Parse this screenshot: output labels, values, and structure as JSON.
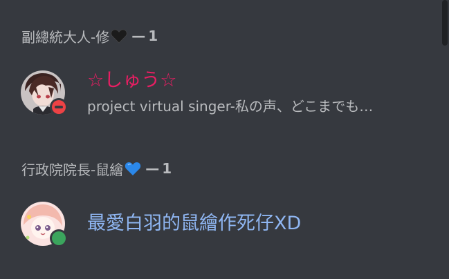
{
  "member_list": {
    "groups": [
      {
        "role": "副總統大人-修",
        "heart_emoji": "black-heart",
        "separator": "—",
        "count": "1",
        "members": [
          {
            "name": "☆しゅう☆",
            "activity": "project virtual singer-私の声、どこまでも…",
            "status": "do-not-disturb",
            "name_color": "#e91e63"
          }
        ]
      },
      {
        "role": "行政院院長-鼠繪",
        "heart_emoji": "blue-heart",
        "separator": "—",
        "count": "1",
        "members": [
          {
            "name": "最愛白羽的鼠繪作死仔XD",
            "status": "online",
            "name_color": "#8fb6f2"
          }
        ]
      }
    ]
  },
  "colors": {
    "background": "#36393f",
    "header_text": "#b9bbbe",
    "dnd": "#ed4245",
    "online": "#3ba55d",
    "scrollbar": "#202225"
  }
}
